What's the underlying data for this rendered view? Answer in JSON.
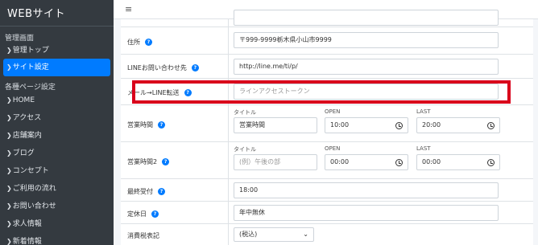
{
  "brand": "WEBサイト",
  "sidebar": {
    "section1": "管理画面",
    "items1": [
      {
        "label": "管理トップ",
        "active": false
      },
      {
        "label": "サイト設定",
        "active": true
      }
    ],
    "section2": "各種ページ設定",
    "items2": [
      {
        "label": "HOME"
      },
      {
        "label": "アクセス"
      },
      {
        "label": "店舗案内"
      },
      {
        "label": "ブログ"
      },
      {
        "label": "コンセプト"
      },
      {
        "label": "ご利用の流れ"
      },
      {
        "label": "お問い合わせ"
      },
      {
        "label": "求人情報"
      },
      {
        "label": "新着情報"
      }
    ]
  },
  "topbar": {
    "menu_icon": "≡"
  },
  "form": {
    "address": {
      "label": "住所",
      "value": "〒999-9999栃木県小山市9999"
    },
    "line_url": {
      "label": "LINEお問い合わせ先",
      "value": "http://line.me/ti/p/"
    },
    "line_mail": {
      "label": "メール→LINE転送",
      "placeholder": "ラインアクセストークン"
    },
    "hours1": {
      "label": "営業時間",
      "title_label": "タイトル",
      "title_value": "営業時間",
      "open_label": "OPEN",
      "open_value": "10:00",
      "last_label": "LAST",
      "last_value": "20:00"
    },
    "hours2": {
      "label": "営業時間2",
      "title_label": "タイトル",
      "title_placeholder": "(例）午後の部",
      "open_label": "OPEN",
      "open_value": "00:00",
      "last_label": "LAST",
      "last_value": "00:00"
    },
    "last_order": {
      "label": "最終受付",
      "value": "18:00"
    },
    "holiday": {
      "label": "定休日",
      "value": "年中無休"
    },
    "tax": {
      "label": "消費税表記",
      "value": "(税込)"
    }
  },
  "colors": {
    "sidebar_bg": "#343a40",
    "active": "#007bff",
    "highlight": "#d9001b"
  }
}
